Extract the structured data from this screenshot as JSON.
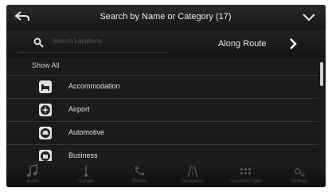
{
  "header": {
    "title": "Search by Name or Category (17)",
    "back_icon": "back-arrow-icon",
    "dropdown_icon": "chevron-down-icon"
  },
  "search": {
    "placeholder": "Search Locations",
    "route_label": "Along Route",
    "route_icon": "chevron-right-icon"
  },
  "list": {
    "show_all": "Show All",
    "items": [
      {
        "label": "Accommodation",
        "icon": "bed-icon"
      },
      {
        "label": "Airport",
        "icon": "airplane-icon"
      },
      {
        "label": "Automotive",
        "icon": "car-icon"
      },
      {
        "label": "Business",
        "icon": "briefcase-icon"
      }
    ]
  },
  "nav": [
    {
      "label": "Audio",
      "icon": "music-note-icon"
    },
    {
      "label": "Climate",
      "icon": "thermometer-icon"
    },
    {
      "label": "Phone",
      "icon": "phone-icon"
    },
    {
      "label": "Navigation",
      "icon": "road-icon"
    },
    {
      "label": "Uconnect Apps",
      "icon": "apps-grid-icon"
    },
    {
      "label": "Settings",
      "icon": "gear-icon"
    }
  ],
  "colors": {
    "background": "#1b1b1b",
    "text": "#e0e0e0",
    "icon_tile": "#e2e2e2"
  }
}
